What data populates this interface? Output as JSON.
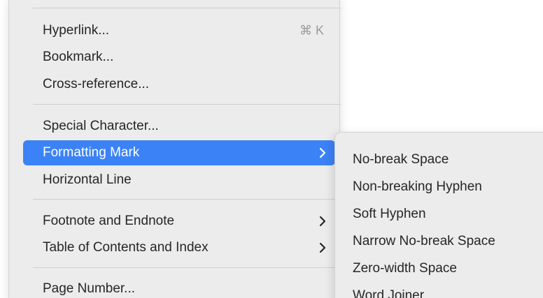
{
  "menu": {
    "items": [
      {
        "label": "Hyperlink...",
        "shortcut": "⌘ K"
      },
      {
        "label": "Bookmark..."
      },
      {
        "label": "Cross-reference..."
      },
      {
        "label": "Special Character..."
      },
      {
        "label": "Formatting Mark",
        "submenu": true,
        "active": true
      },
      {
        "label": "Horizontal Line"
      },
      {
        "label": "Footnote and Endnote",
        "submenu": true
      },
      {
        "label": "Table of Contents and Index",
        "submenu": true
      },
      {
        "label": "Page Number..."
      }
    ]
  },
  "submenu": {
    "items": [
      {
        "label": "No-break Space"
      },
      {
        "label": "Non-breaking Hyphen"
      },
      {
        "label": "Soft Hyphen"
      },
      {
        "label": "Narrow No-break Space"
      },
      {
        "label": "Zero-width Space"
      },
      {
        "label": "Word Joiner"
      }
    ]
  },
  "colors": {
    "menu_background": "#ececec",
    "highlight": "#3b82f6",
    "text": "#262626",
    "shortcut_text": "#9a9a9a",
    "separator": "#cfcfcf"
  },
  "icons": {
    "submenu_arrow": "chevron-right-icon"
  }
}
